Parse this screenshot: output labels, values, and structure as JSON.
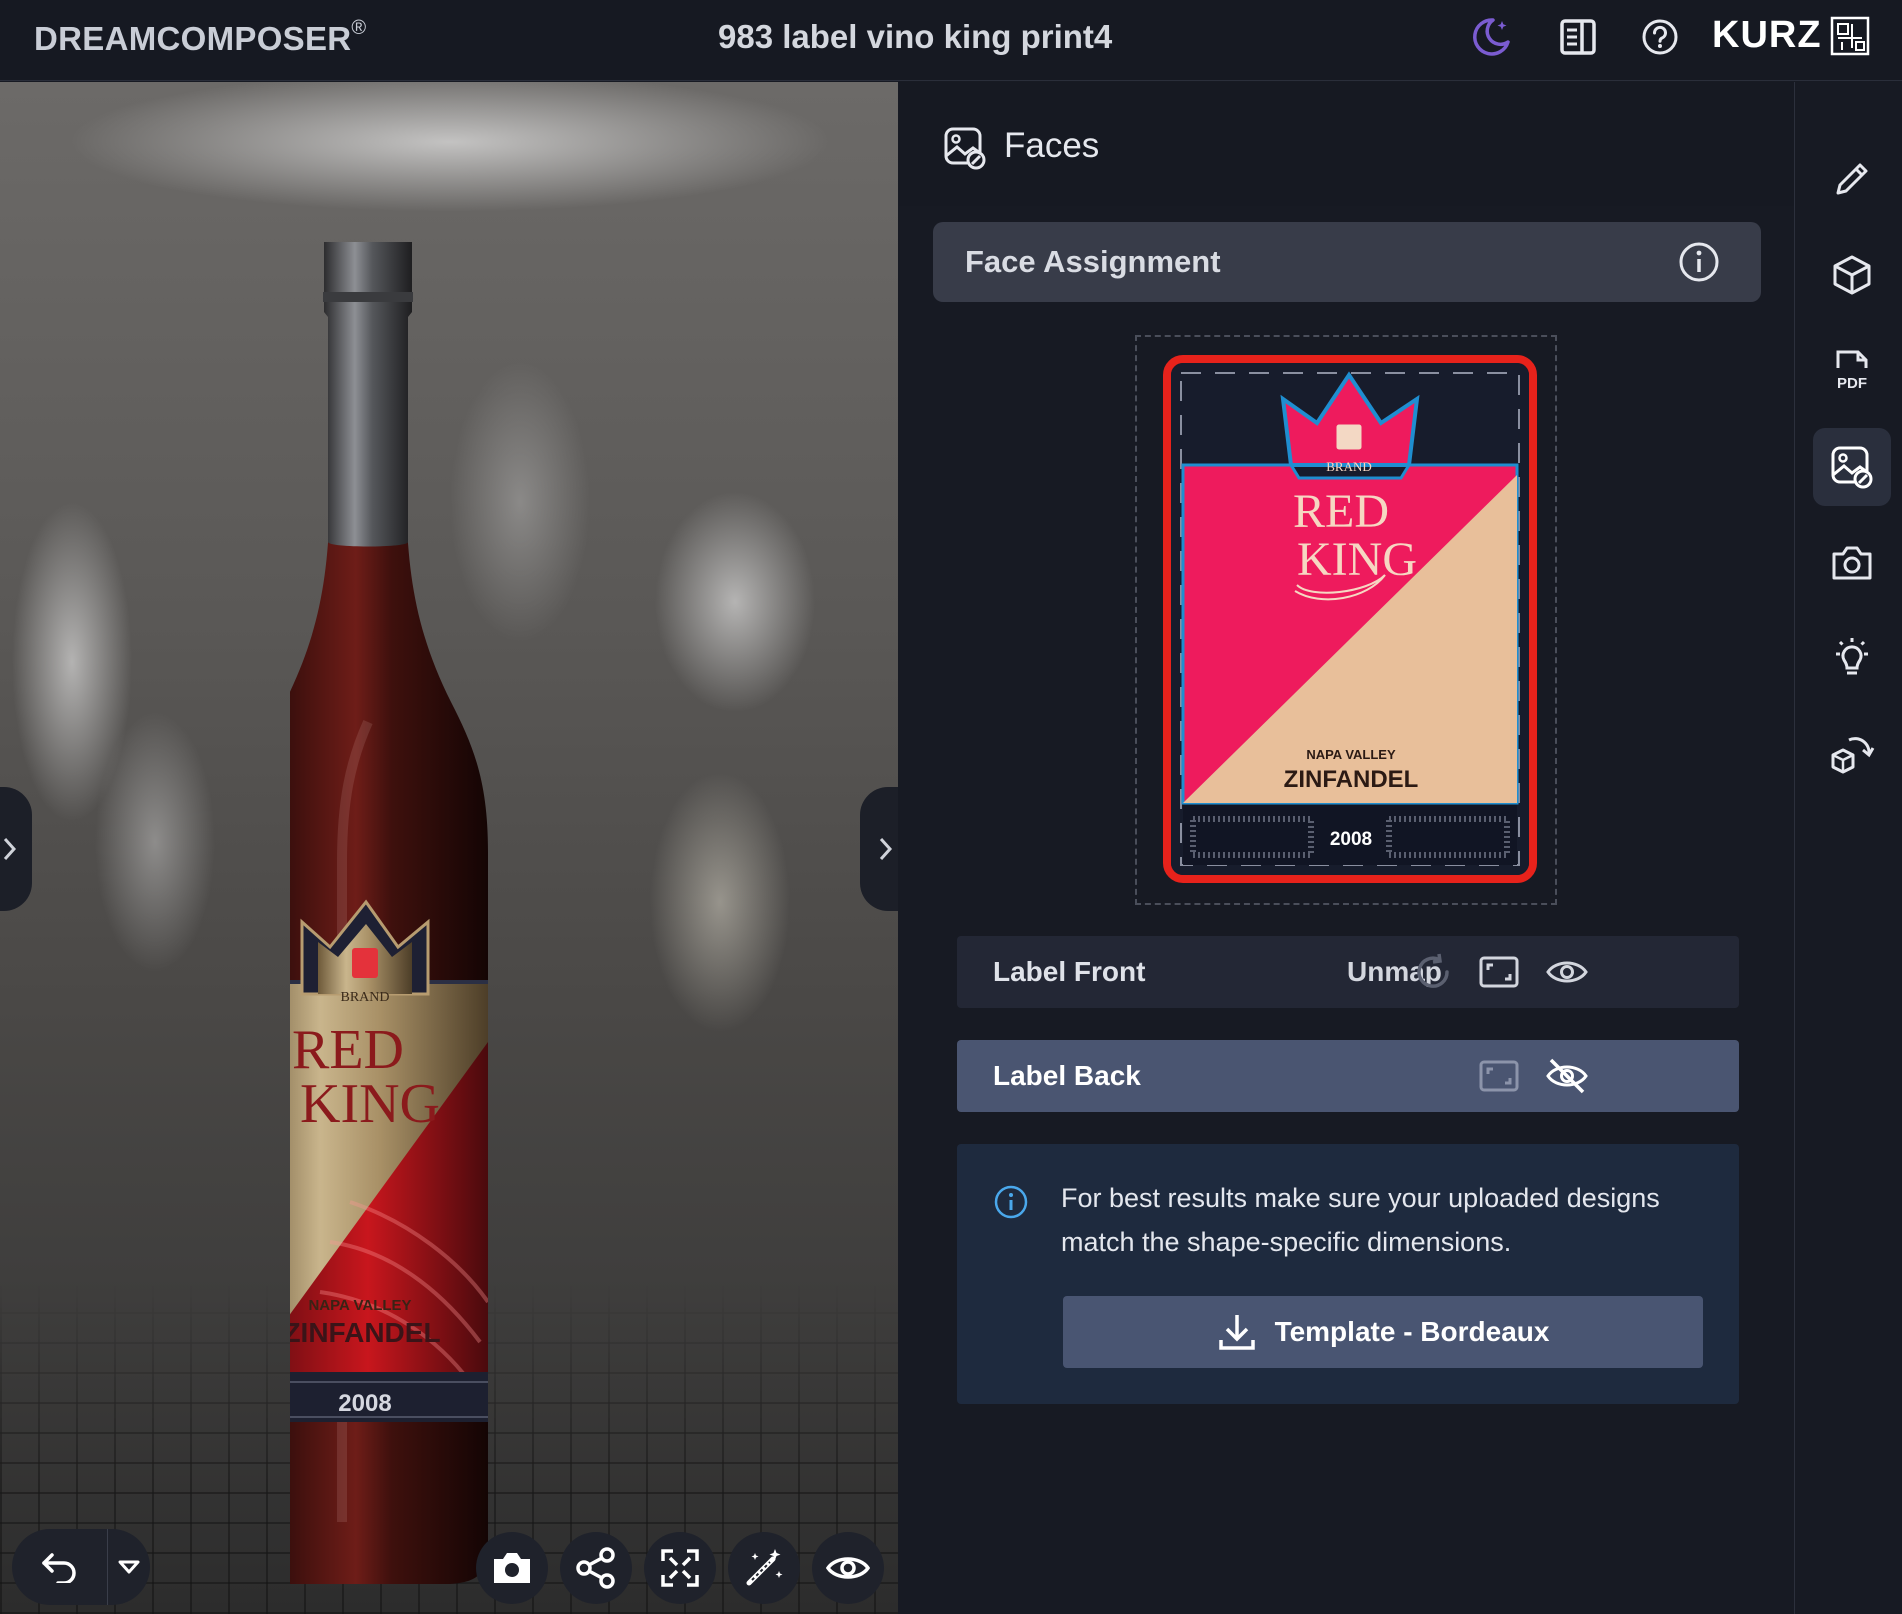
{
  "app": {
    "brand": "DREAMCOMPOSER",
    "brand_mark": "®",
    "document_title": "983 label vino king print4",
    "logo_text": "KURZ",
    "header_icons": [
      "dark-mode-icon",
      "notes-icon",
      "help-icon"
    ]
  },
  "viewport": {
    "bottle_label": {
      "brand_small": "BRAND",
      "name_line1": "RED",
      "name_line2": "KING",
      "region": "NAPA VALLEY",
      "varietal": "ZINFANDEL",
      "year": "2008"
    },
    "toolbar_icons": [
      "undo-icon",
      "dropdown-icon",
      "camera-icon",
      "share-icon",
      "fullscreen-icon",
      "magic-wand-icon",
      "eye-icon"
    ]
  },
  "faces_panel": {
    "title": "Faces",
    "section_title": "Face Assignment",
    "preview_label": {
      "brand_small": "BRAND",
      "name_line1": "RED",
      "name_line2": "KING",
      "region": "NAPA VALLEY",
      "varietal": "ZINFANDEL",
      "year": "2008"
    },
    "faces": [
      {
        "label": "Label Front",
        "action": "Unmap",
        "visible": true
      },
      {
        "label": "Label Back",
        "visible": false
      }
    ],
    "info": {
      "text": "For best results make sure your uploaded designs match the shape-specific dimensions.",
      "template_button": "Template - Bordeaux"
    }
  },
  "right_toolbar": {
    "items": [
      "edit-icon",
      "cube-icon",
      "pdf-icon",
      "faces-icon",
      "camera-icon",
      "light-icon",
      "rotate-cube-icon"
    ],
    "active": "faces-icon"
  },
  "colors": {
    "accent_red": "#e7221b",
    "label_pink": "#ee1b5d",
    "label_beige": "#e8bf9a",
    "active_row": "#4a5571",
    "info_bg": "#1e2a3e"
  }
}
